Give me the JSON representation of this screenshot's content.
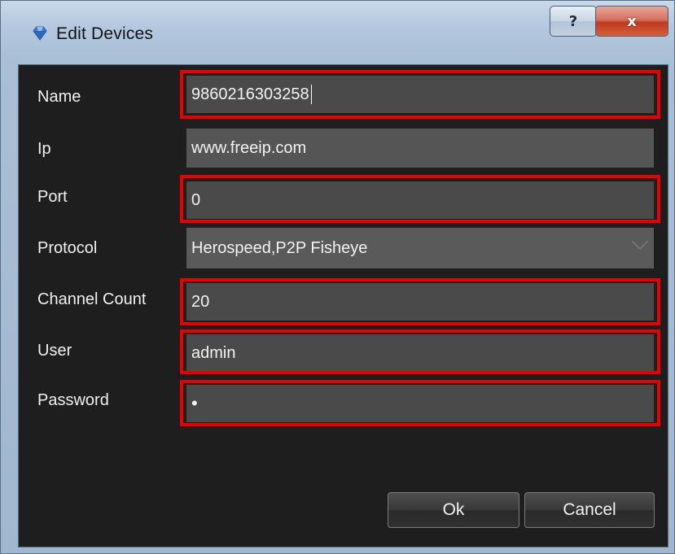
{
  "window": {
    "title": "Edit Devices",
    "help_label": "?",
    "close_label": "x"
  },
  "form": {
    "name": {
      "label": "Name",
      "value": "9860216303258"
    },
    "ip": {
      "label": "Ip",
      "value": "www.freeip.com"
    },
    "port": {
      "label": "Port",
      "value": "0"
    },
    "protocol": {
      "label": "Protocol",
      "value": "Herospeed,P2P Fisheye"
    },
    "channel_count": {
      "label": "Channel Count",
      "value": "20"
    },
    "user": {
      "label": "User",
      "value": "admin"
    },
    "password": {
      "label": "Password",
      "value": "•"
    }
  },
  "buttons": {
    "ok": "Ok",
    "cancel": "Cancel"
  },
  "colors": {
    "background": "#1e1e1e",
    "field": "#4a4a4a",
    "highlight": "#ea0000"
  },
  "icons": {
    "title": "app-diamond-icon",
    "dropdown": "chevron-down-icon"
  }
}
